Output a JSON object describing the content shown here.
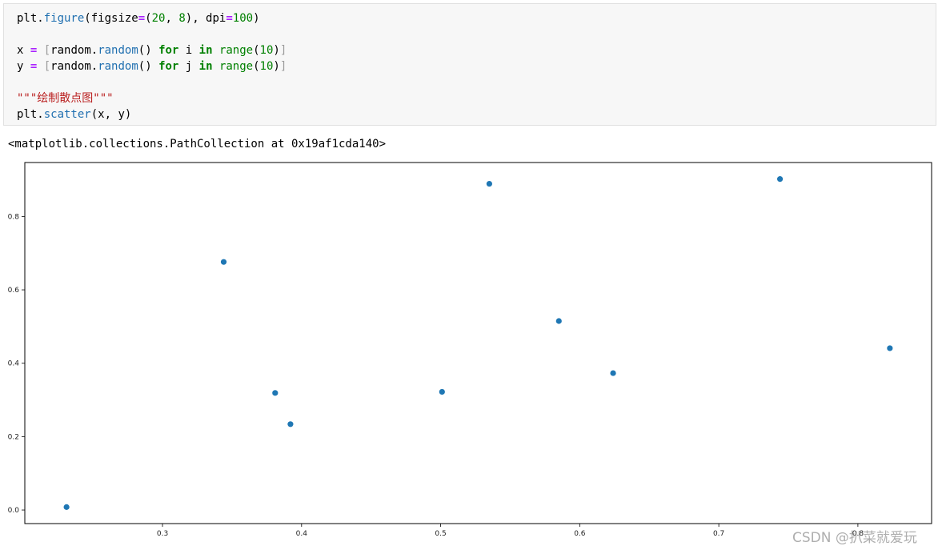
{
  "code_cell": {
    "lines": [
      [
        {
          "t": "plt.",
          "c": ""
        },
        {
          "t": "figure",
          "c": "tok-fn"
        },
        {
          "t": "(figsize",
          "c": ""
        },
        {
          "t": "=",
          "c": "tok-op"
        },
        {
          "t": "(",
          "c": ""
        },
        {
          "t": "20",
          "c": "tok-num"
        },
        {
          "t": ", ",
          "c": ""
        },
        {
          "t": "8",
          "c": "tok-num"
        },
        {
          "t": "), dpi",
          "c": ""
        },
        {
          "t": "=",
          "c": "tok-op"
        },
        {
          "t": "100",
          "c": "tok-num"
        },
        {
          "t": ")",
          "c": ""
        }
      ],
      [],
      [
        {
          "t": "x ",
          "c": ""
        },
        {
          "t": "=",
          "c": "tok-op"
        },
        {
          "t": " ",
          "c": ""
        },
        {
          "t": "[",
          "c": "tok-br"
        },
        {
          "t": "random.",
          "c": ""
        },
        {
          "t": "random",
          "c": "tok-fn"
        },
        {
          "t": "() ",
          "c": ""
        },
        {
          "t": "for",
          "c": "tok-kw"
        },
        {
          "t": " i ",
          "c": ""
        },
        {
          "t": "in",
          "c": "tok-kw"
        },
        {
          "t": " ",
          "c": ""
        },
        {
          "t": "range",
          "c": "tok-num"
        },
        {
          "t": "(",
          "c": ""
        },
        {
          "t": "10",
          "c": "tok-num"
        },
        {
          "t": ")",
          "c": ""
        },
        {
          "t": "]",
          "c": "tok-br"
        }
      ],
      [
        {
          "t": "y ",
          "c": ""
        },
        {
          "t": "=",
          "c": "tok-op"
        },
        {
          "t": " ",
          "c": ""
        },
        {
          "t": "[",
          "c": "tok-br"
        },
        {
          "t": "random.",
          "c": ""
        },
        {
          "t": "random",
          "c": "tok-fn"
        },
        {
          "t": "() ",
          "c": ""
        },
        {
          "t": "for",
          "c": "tok-kw"
        },
        {
          "t": " j ",
          "c": ""
        },
        {
          "t": "in",
          "c": "tok-kw"
        },
        {
          "t": " ",
          "c": ""
        },
        {
          "t": "range",
          "c": "tok-num"
        },
        {
          "t": "(",
          "c": ""
        },
        {
          "t": "10",
          "c": "tok-num"
        },
        {
          "t": ")",
          "c": ""
        },
        {
          "t": "]",
          "c": "tok-br"
        }
      ],
      [],
      [
        {
          "t": "\"\"\"绘制散点图\"\"\"",
          "c": "tok-str"
        }
      ],
      [
        {
          "t": "plt.",
          "c": ""
        },
        {
          "t": "scatter",
          "c": "tok-fn"
        },
        {
          "t": "(x, y)",
          "c": ""
        }
      ]
    ]
  },
  "output_text": "<matplotlib.collections.PathCollection at 0x19af1cda140>",
  "chart_data": {
    "type": "scatter",
    "x": [
      0.231,
      0.344,
      0.381,
      0.392,
      0.501,
      0.535,
      0.585,
      0.624,
      0.744,
      0.823
    ],
    "y": [
      0.008,
      0.676,
      0.319,
      0.234,
      0.322,
      0.889,
      0.515,
      0.373,
      0.902,
      0.441
    ],
    "xticks": [
      "0.3",
      "0.4",
      "0.5",
      "0.6",
      "0.7",
      "0.8"
    ],
    "yticks": [
      "0.0",
      "0.2",
      "0.4",
      "0.6",
      "0.8"
    ],
    "xlim": [
      0.201,
      0.853
    ],
    "ylim": [
      -0.037,
      0.947
    ],
    "marker_color": "#1f77b4",
    "title": "",
    "xlabel": "",
    "ylabel": "",
    "grid": false
  },
  "watermark": "CSDN @扒菜就爱玩"
}
